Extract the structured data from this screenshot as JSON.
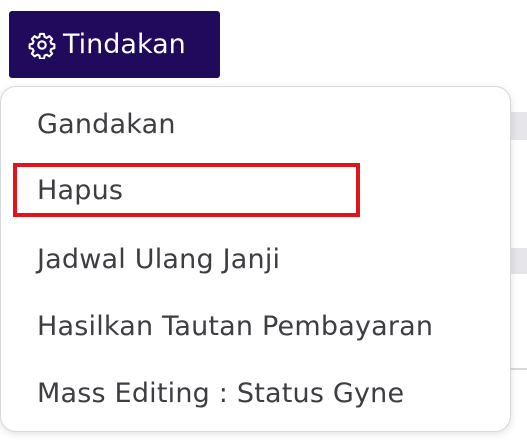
{
  "action_button": {
    "label": "Tindakan",
    "icon": "gear-icon",
    "background_color": "#1f0a5c",
    "text_color": "#ffffff"
  },
  "dropdown": {
    "items": [
      {
        "label": "Gandakan"
      },
      {
        "label": "Hapus",
        "highlighted": true
      },
      {
        "label": "Jadwal Ulang Janji"
      },
      {
        "label": "Hasilkan Tautan Pembayaran"
      },
      {
        "label": "Mass Editing : Status Gyne"
      }
    ],
    "highlight_color": "#e0141c"
  }
}
